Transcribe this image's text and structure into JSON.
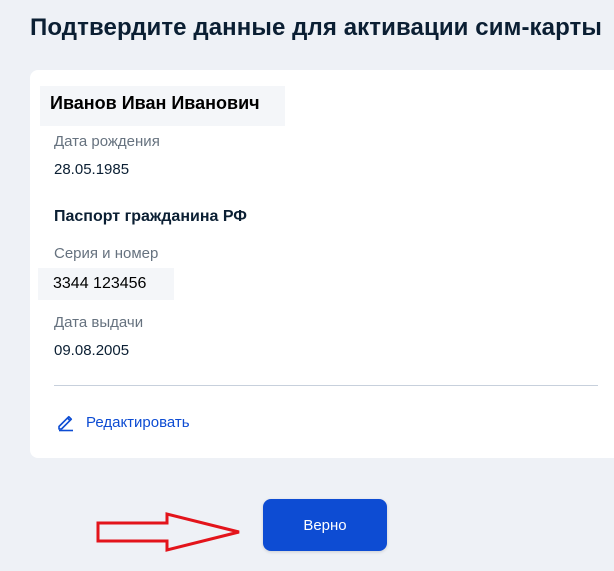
{
  "page": {
    "title": "Подтвердите данные для активации сим-карты"
  },
  "person": {
    "full_name": "Иванов Иван Иванович",
    "birth_date_label": "Дата рождения",
    "birth_date": "28.05.1985"
  },
  "passport": {
    "section_title": "Паспорт гражданина РФ",
    "serial_label": "Серия и номер",
    "serial_value": "3344 123456",
    "issue_date_label": "Дата выдачи",
    "issue_date": "09.08.2005"
  },
  "actions": {
    "edit_label": "Редактировать",
    "edit_icon": "pencil-icon",
    "confirm_label": "Верно"
  },
  "colors": {
    "accent": "#0d4cd3",
    "background": "#eef1f6",
    "card": "#ffffff",
    "arrow": "#e3141b"
  }
}
